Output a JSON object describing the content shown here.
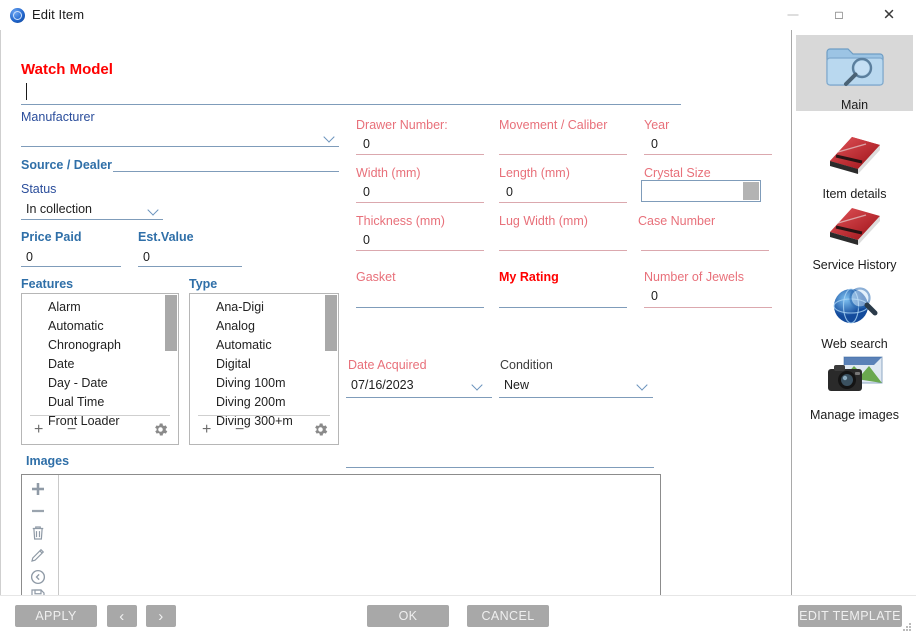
{
  "window": {
    "title": "Edit Item",
    "icon": "app-icon",
    "minimize": "—",
    "maximize": "□",
    "close": "✕"
  },
  "form": {
    "heading": "Watch Model",
    "model_value": "",
    "left_column": [
      {
        "label": "Manufacturer",
        "value": "",
        "control": "combobox"
      },
      {
        "label": "Source / Dealer",
        "value": "",
        "control": "inline-text"
      },
      {
        "label": "Status",
        "value": "In collection",
        "control": "dropdown"
      },
      {
        "label": "Price Paid",
        "value": "0",
        "control": "text"
      },
      {
        "label": "Est.Value",
        "value": "0",
        "control": "text"
      }
    ],
    "mid_column": [
      {
        "label": "Drawer Number:",
        "value": "0"
      },
      {
        "label": "Width (mm)",
        "value": "0"
      },
      {
        "label": "Thickness (mm)",
        "value": "0"
      },
      {
        "label": "Gasket",
        "value": ""
      }
    ],
    "mid2_column": [
      {
        "label": "Movement / Caliber",
        "value": ""
      },
      {
        "label": "Length (mm)",
        "value": "0"
      },
      {
        "label": "Lug Width (mm)",
        "value": ""
      },
      {
        "label": "My Rating",
        "value": ""
      }
    ],
    "right_column": [
      {
        "label": "Year",
        "value": "0"
      },
      {
        "label": "Crystal Size",
        "value": "",
        "control": "combobox"
      },
      {
        "label": "Case Number",
        "value": ""
      },
      {
        "label": "Number of Jewels",
        "value": "0"
      }
    ],
    "date_acquired": {
      "label": "Date Acquired",
      "value": "07/16/2023"
    },
    "condition": {
      "label": "Condition",
      "value": "New"
    }
  },
  "features": {
    "label": "Features",
    "items": [
      "Alarm",
      "Automatic",
      "Chronograph",
      "Date",
      "Day - Date",
      "Dual Time",
      "Front Loader"
    ],
    "tools": {
      "add": "+",
      "remove": "−",
      "settings": "gear"
    }
  },
  "type": {
    "label": "Type",
    "items": [
      "Ana-Digi",
      "Analog",
      "Automatic",
      "Digital",
      "Diving 100m",
      "Diving 200m",
      "Diving 300+m"
    ],
    "tools": {
      "add": "+",
      "remove": "−",
      "settings": "gear"
    }
  },
  "images": {
    "label": "Images",
    "tools": [
      "add-icon",
      "remove-icon",
      "trash-icon",
      "edit-icon",
      "back-icon",
      "save-icon"
    ]
  },
  "sidebar": {
    "items": [
      {
        "label": "Main",
        "icon": "folder-search-icon",
        "selected": true
      },
      {
        "label": "Item details",
        "icon": "red-book-icon",
        "selected": false
      },
      {
        "label": "Service History",
        "icon": "red-book-icon",
        "selected": false
      },
      {
        "label": "Web search",
        "icon": "globe-search-icon",
        "selected": false
      },
      {
        "label": "Manage images",
        "icon": "camera-photo-icon",
        "selected": false
      }
    ]
  },
  "footer": {
    "apply": "APPLY",
    "prev": "‹",
    "next": "›",
    "ok": "OK",
    "cancel": "CANCEL",
    "edit_template": "EDIT TEMPLATE"
  },
  "colors": {
    "heading_red": "#ff0000",
    "label_blue": "#2f6fa8",
    "label_red": "#e8707a",
    "underline": "#7f9cba",
    "button_gray": "#a8a8a8",
    "selected_bg": "#d8d8d8"
  }
}
